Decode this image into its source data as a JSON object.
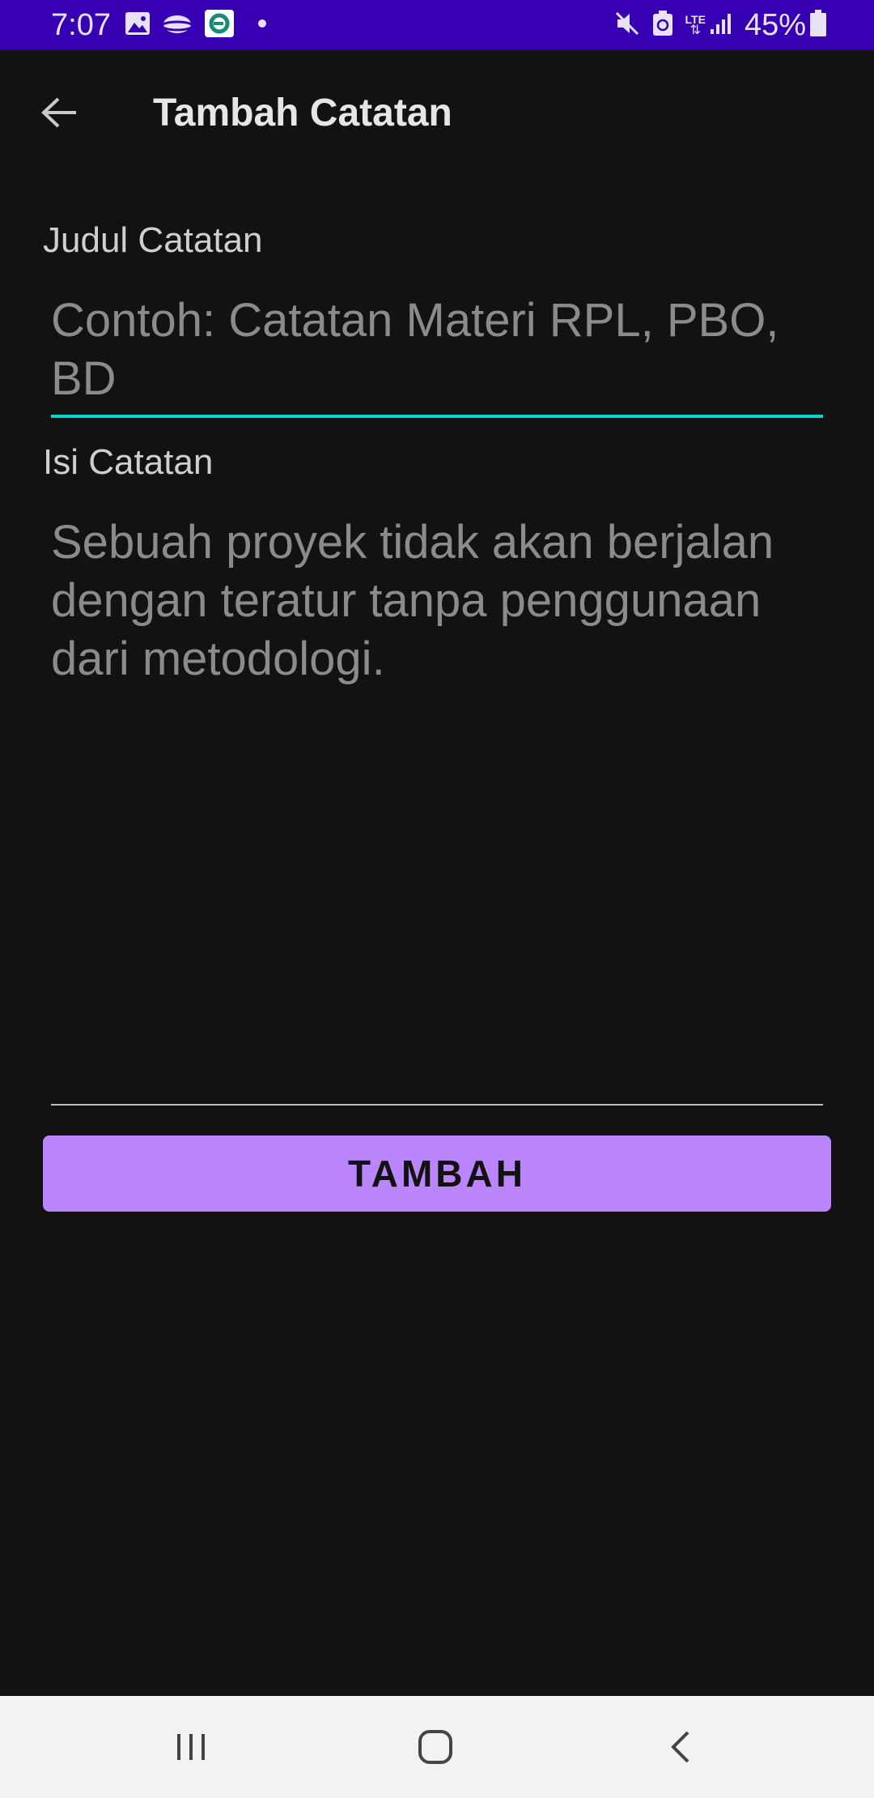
{
  "status_bar": {
    "time": "7:07",
    "battery": "45%",
    "network": "LTE",
    "left_icons": [
      "image-icon",
      "cloud-icon",
      "app-notification-icon",
      "dot-icon"
    ],
    "right_icons": [
      "mute-icon",
      "battery-saver-icon",
      "lte-icon",
      "signal-icon",
      "battery-icon"
    ]
  },
  "app_bar": {
    "title": "Tambah Catatan",
    "back_icon": "arrow-left-icon"
  },
  "form": {
    "title_label": "Judul Catatan",
    "title_placeholder": "Contoh: Catatan Materi RPL, PBO, BD",
    "body_label": "Isi Catatan",
    "body_placeholder": "Sebuah proyek tidak akan berjalan dengan teratur tanpa penggunaan dari metodologi.",
    "submit_label": "TAMBAH"
  },
  "nav_bar": {
    "buttons": [
      "recents-icon",
      "home-icon",
      "back-icon"
    ]
  },
  "colors": {
    "status_bar": "#3700b3",
    "background": "#121212",
    "accent_teal": "#03dac5",
    "button": "#bb86fc",
    "nav_bar": "#f2f2f2"
  }
}
